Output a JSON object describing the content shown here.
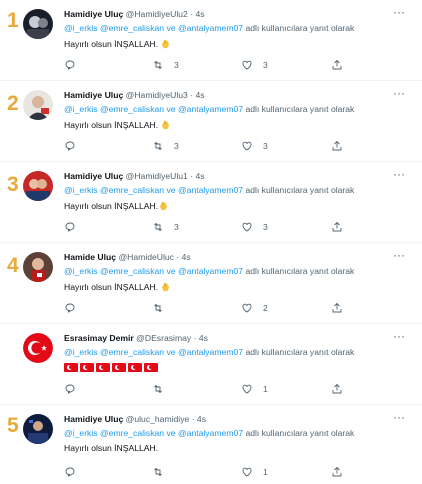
{
  "accent_color": "#1d9bf0",
  "number_color": "#e8a93c",
  "tweets": [
    {
      "number": "1",
      "name": "Hamidiye Uluç",
      "handle": "@HamidiyeUlu2",
      "time": "· 4s",
      "mention1": "@i_erkis",
      "mention2": "@emre_caliskan",
      "conj": "ve",
      "mention3": "@antalyamem07",
      "reply_suffix": "adlı kullanıcılara yanıt olarak",
      "text": "Hayırlı olsun İNŞALLAH.",
      "retweets": "3",
      "likes": "3",
      "emoji": "clapping-hands-icon"
    },
    {
      "number": "2",
      "name": "Hamidiye Uluç",
      "handle": "@HamidiyeUlu3",
      "time": "· 4s",
      "mention1": "@i_erkis",
      "mention2": "@emre_caliskan",
      "conj": "ve",
      "mention3": "@antalyamem07",
      "reply_suffix": "adlı kullanıcılara yanıt olarak",
      "text": "Hayırlı olsun İNŞALLAH.",
      "retweets": "3",
      "likes": "3",
      "emoji": "clapping-hands-icon"
    },
    {
      "number": "3",
      "name": "Hamidiye Uluç",
      "handle": "@HamidiyeUlu1",
      "time": "· 4s",
      "mention1": "@i_erkis",
      "mention2": "@emre_caliskan",
      "conj": "ve",
      "mention3": "@antalyamem07",
      "reply_suffix": "adlı kullanıcılara yanıt olarak",
      "text": "Hayırlı olsun İNŞALLAH.",
      "retweets": "3",
      "likes": "3",
      "emoji": "clapping-hands-icon"
    },
    {
      "number": "4",
      "name": "Hamide Uluç",
      "handle": "@HamideUluc",
      "time": "· 4s",
      "mention1": "@i_erkis",
      "mention2": "@emre_caliskan",
      "conj": "ve",
      "mention3": "@antalyamem07",
      "reply_suffix": "adlı kullanıcılara yanıt olarak",
      "text": "Hayırlı olsun İNŞALLAH.",
      "retweets": "",
      "likes": "2",
      "emoji": "clapping-hands-icon"
    },
    {
      "number": "",
      "name": "Esrasimay Demir",
      "handle": "@DEsrasimay",
      "time": "· 4s",
      "mention1": "@i_erkis",
      "mention2": "@emre_caliskan",
      "conj": "ve",
      "mention3": "@antalyamem07",
      "reply_suffix": "adlı kullanıcılara yanıt olarak",
      "text": "",
      "retweets": "",
      "likes": "1",
      "emoji": "turkish-flags"
    },
    {
      "number": "5",
      "name": "Hamidiye Uluç",
      "handle": "@uluc_hamidiye",
      "time": "· 4s",
      "mention1": "@i_erkis",
      "mention2": "@emre_caliskan",
      "conj": "ve",
      "mention3": "@antalyamem07",
      "reply_suffix": "adlı kullanıcılara yanıt olarak",
      "text": "Hayırlı olsun İNŞALLAH.",
      "retweets": "",
      "likes": "1",
      "emoji": ""
    }
  ]
}
